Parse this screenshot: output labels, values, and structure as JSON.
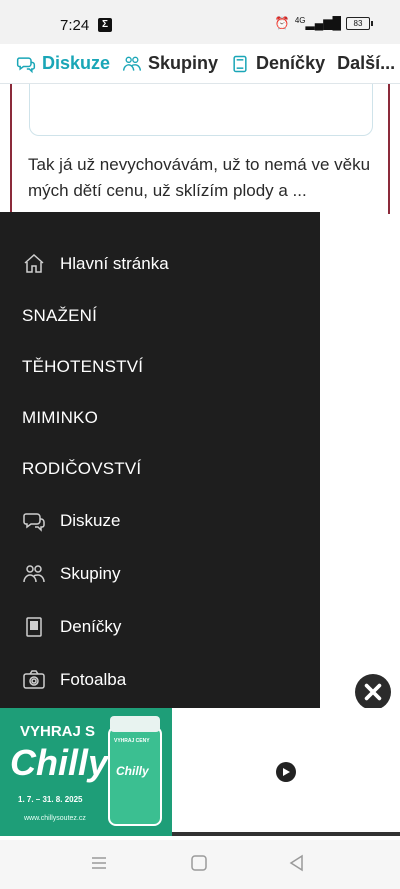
{
  "status_bar": {
    "time": "7:24",
    "notification_icon": "Σ",
    "signal_text": "4G",
    "battery": "83"
  },
  "top_nav": {
    "items": [
      {
        "label": "Diskuze",
        "icon": "chat-icon",
        "active": true
      },
      {
        "label": "Skupiny",
        "icon": "people-icon",
        "active": false
      },
      {
        "label": "Deníčky",
        "icon": "book-icon",
        "active": false
      },
      {
        "label": "Další...",
        "icon": "",
        "active": false
      }
    ]
  },
  "content": {
    "paragraph": "Tak já už nevychovávám, už to nemá ve věku mých dětí cenu, už sklízím plody a ..."
  },
  "drawer": {
    "home": "Hlavní stránka",
    "sections": [
      "SNAŽENÍ",
      "TĚHOTENSTVÍ",
      "MIMINKO",
      "RODIČOVSTVÍ"
    ],
    "links": [
      {
        "label": "Diskuze",
        "icon": "chat-icon"
      },
      {
        "label": "Skupiny",
        "icon": "people-icon"
      },
      {
        "label": "Deníčky",
        "icon": "book-icon"
      },
      {
        "label": "Fotoalba",
        "icon": "camera-icon"
      }
    ]
  },
  "ad": {
    "headline": "VYHRAJ S",
    "brand": "Chilly",
    "dates": "1. 7. – 31. 8. 2025",
    "url": "www.chillysoutez.cz",
    "bottle_label": "Chilly",
    "bottle_top": "VYHRAJ CENY"
  },
  "colors": {
    "accent": "#1aa6b7",
    "drawer_bg": "#1e1e1e",
    "ad_green": "#1e9e78"
  }
}
